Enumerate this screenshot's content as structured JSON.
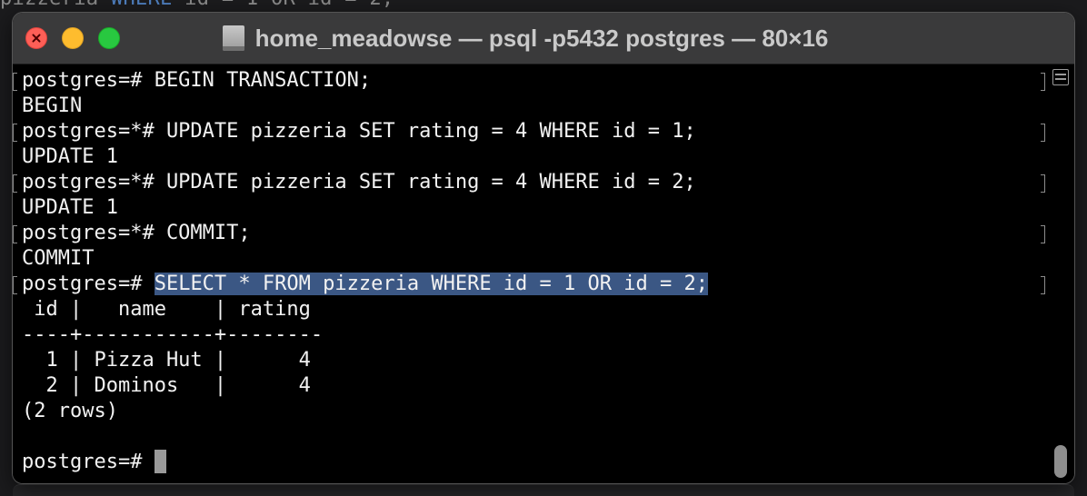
{
  "background": {
    "partial_line_prefix": "pizzeria ",
    "partial_line_keyword": "WHERE",
    "partial_line_rest": " id = 1 OR id = 2;"
  },
  "window": {
    "title": "home_meadowse — psql -p5432 postgres — 80×16",
    "traffic_lights": [
      "close",
      "minimize",
      "zoom"
    ]
  },
  "terminal": {
    "lines": [
      "postgres=# BEGIN TRANSACTION;",
      "BEGIN",
      "postgres=*# UPDATE pizzeria SET rating = 4 WHERE id = 1;",
      "UPDATE 1",
      "postgres=*# UPDATE pizzeria SET rating = 4 WHERE id = 2;",
      "UPDATE 1",
      "postgres=*# COMMIT;",
      "COMMIT",
      "postgres=# ",
      " id |   name    | rating ",
      "----+-----------+--------",
      "  1 | Pizza Hut |      4",
      "  2 | Dominos   |      4",
      "(2 rows)",
      "",
      "postgres=# "
    ],
    "selected_command": "SELECT * FROM pizzeria WHERE id = 1 OR id = 2;",
    "colors": {
      "background": "#000000",
      "text": "#f2f2f2",
      "selection": "#3b5784",
      "cursor": "#9a9a9a"
    }
  }
}
